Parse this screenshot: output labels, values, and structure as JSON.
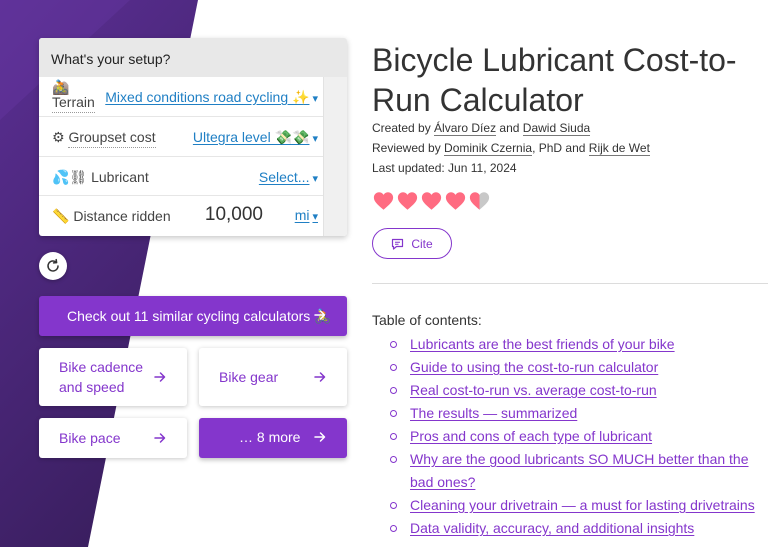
{
  "setup": {
    "header": "What's your setup?",
    "rows": [
      {
        "icon": "🚵",
        "label": "Terrain",
        "value": "Mixed conditions road cycling ✨"
      },
      {
        "icon": "⚙",
        "label": "Groupset cost",
        "value": "Ultegra level 💸💸"
      },
      {
        "icon": "💦⛓",
        "label": "Lubricant",
        "value": "Select..."
      },
      {
        "icon": "📏",
        "label": "Distance ridden",
        "value": "10,000",
        "unit": "mi"
      }
    ],
    "caret": "▾"
  },
  "calculators": {
    "similar_label": "Check out 11 similar cycling calculators 🚴",
    "links": [
      {
        "label_line1": "Bike cadence",
        "label_line2": "and speed"
      },
      {
        "label": "Bike gear"
      },
      {
        "label": "Bike pace"
      }
    ],
    "more_label": "… 8 more"
  },
  "article": {
    "title": "Bicycle Lubricant Cost-to-Run Calculator",
    "created_prefix": "Created by",
    "created_by": [
      "Álvaro Díez",
      "Dawid Siuda"
    ],
    "reviewed_prefix": "Reviewed by",
    "reviewed_by": [
      "Dominik Czernia",
      "Rijk de Wet"
    ],
    "reviewed_suffix": ", PhD and",
    "and": "and",
    "last_updated": "Last updated: Jun 11, 2024",
    "rating": {
      "value": 4.5,
      "max": 5
    },
    "cite_label": "Cite"
  },
  "toc": {
    "title": "Table of contents:",
    "items": [
      "Lubricants are the best friends of your bike",
      "Guide to using the cost-to-run calculator",
      "Real cost-to-run vs. average cost-to-run",
      "The results — summarized",
      "Pros and cons of each type of lubricant",
      "Why are the good lubricants SO MUCH better than the bad ones?",
      "Cleaning your drivetrain — a must for lasting drivetrains",
      "Data validity, accuracy, and additional insights"
    ]
  },
  "colors": {
    "accent": "#8436cc",
    "link_blue": "#1f7fc4",
    "heart": "#ff6b81",
    "background_purple": "#4a2778"
  }
}
